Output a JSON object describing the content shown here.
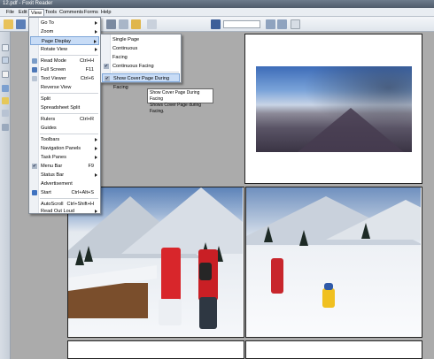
{
  "window": {
    "title": "12.pdf - Foxit Reader"
  },
  "menubar": {
    "items": [
      "File",
      "Edit",
      "View",
      "Tools",
      "Comments",
      "Forms",
      "Help"
    ]
  },
  "view_menu": {
    "items": [
      {
        "label": "Go To",
        "submenu": true
      },
      {
        "label": "Zoom",
        "submenu": true
      },
      {
        "label": "Page Display",
        "submenu": true
      },
      {
        "label": "Rotate View",
        "submenu": true
      },
      {
        "label": "Read Mode",
        "shortcut": "Ctrl+H"
      },
      {
        "label": "Full Screen",
        "shortcut": "F11"
      },
      {
        "label": "Text Viewer",
        "shortcut": "Ctrl+6"
      },
      {
        "label": "Reverse View"
      },
      {
        "label": "Split"
      },
      {
        "label": "Spreadsheet Split"
      },
      {
        "label": "Rulers",
        "shortcut": "Ctrl+R"
      },
      {
        "label": "Guides"
      },
      {
        "label": "Toolbars",
        "submenu": true
      },
      {
        "label": "Navigation Panels",
        "submenu": true
      },
      {
        "label": "Task Panes",
        "submenu": true
      },
      {
        "label": "Menu Bar",
        "shortcut": "F9"
      },
      {
        "label": "Status Bar",
        "submenu": true
      },
      {
        "label": "Advertisement"
      },
      {
        "label": "Start",
        "shortcut": "Ctrl+Alt+S"
      },
      {
        "label": "AutoScroll",
        "shortcut": "Ctrl+Shift+H"
      },
      {
        "label": "Read Out Loud",
        "submenu": true
      }
    ]
  },
  "page_display_submenu": {
    "items": [
      {
        "label": "Single Page"
      },
      {
        "label": "Continuous"
      },
      {
        "label": "Facing"
      },
      {
        "label": "Continuous Facing",
        "checked": true
      },
      {
        "label": "Show Cover Page During  Facing",
        "checked": true
      }
    ]
  },
  "tooltip": {
    "title": "Show Cover Page During  Facing",
    "description": "Shows Cover Page during Facing."
  },
  "colors": {
    "menu_highlight": "#c8dcf6",
    "canvas": "#ababab",
    "toolbar": "#e9edf2"
  }
}
